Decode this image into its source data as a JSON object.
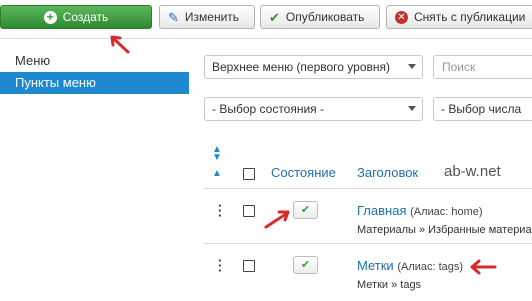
{
  "toolbar": {
    "create_label": "Создать",
    "edit_label": "Изменить",
    "publish_label": "Опубликовать",
    "unpublish_label": "Снять с публикации"
  },
  "sidebar": {
    "items": [
      {
        "label": "Меню",
        "active": false
      },
      {
        "label": "Пункты меню",
        "active": true
      }
    ]
  },
  "filters": {
    "menu_select": "Верхнее меню (первого уровня)",
    "search_placeholder": "Поиск",
    "state_select": "- Выбор состояния -",
    "count_select": "- Выбор числа"
  },
  "table": {
    "headers": {
      "state": "Состояние",
      "title": "Заголовок"
    },
    "watermark": "ab-w.net",
    "rows": [
      {
        "title": "Главная",
        "alias": "(Алиас: home)",
        "subline": "Материалы » Избранные материа"
      },
      {
        "title": "Метки",
        "alias": "(Алиас: tags)",
        "subline": "Метки » tags"
      }
    ]
  },
  "colors": {
    "accent": "#1e88d0",
    "create_green": "#3d9a3d",
    "annotation_red": "#d62b2b"
  }
}
